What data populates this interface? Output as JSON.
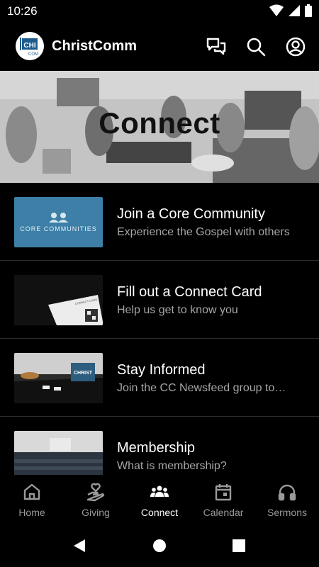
{
  "status": {
    "time": "10:26"
  },
  "app": {
    "title": "ChristComm",
    "logo_text_top": "CHI",
    "logo_text_bottom": "COM"
  },
  "hero": {
    "title": "Connect"
  },
  "items": [
    {
      "title": "Join a Core Community",
      "subtitle": "Experience the Gospel with others",
      "thumb_text": "CORE COMMUNITIES"
    },
    {
      "title": "Fill out a Connect Card",
      "subtitle": "Help us get to know you",
      "thumb_text": "CONNECT CARD"
    },
    {
      "title": "Stay Informed",
      "subtitle": "Join the CC Newsfeed group to…",
      "thumb_text": "CHRIST"
    },
    {
      "title": "Membership",
      "subtitle": "What is membership?"
    }
  ],
  "nav": [
    {
      "label": "Home",
      "icon": "home-icon"
    },
    {
      "label": "Giving",
      "icon": "giving-icon"
    },
    {
      "label": "Connect",
      "icon": "connect-icon",
      "active": true
    },
    {
      "label": "Calendar",
      "icon": "calendar-icon"
    },
    {
      "label": "Sermons",
      "icon": "headphones-icon"
    }
  ],
  "colors": {
    "background": "#000000",
    "subtitle": "#a6a6a6",
    "nav_inactive": "#9a9a9a",
    "core_thumb": "#3d7fa6"
  }
}
